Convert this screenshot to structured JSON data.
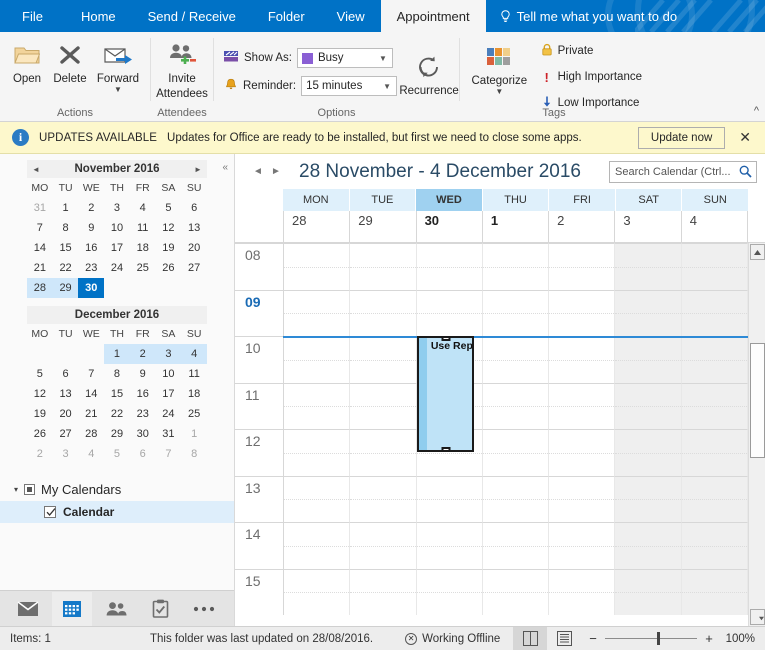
{
  "window": {
    "tabs": [
      {
        "label": "File",
        "active": false
      },
      {
        "label": "Home",
        "active": false
      },
      {
        "label": "Send / Receive",
        "active": false
      },
      {
        "label": "Folder",
        "active": false
      },
      {
        "label": "View",
        "active": false
      },
      {
        "label": "Appointment",
        "active": true
      }
    ],
    "tell_me": "Tell me what you want to do"
  },
  "ribbon": {
    "groups": {
      "actions": {
        "name": "Actions",
        "open": "Open",
        "delete": "Delete",
        "forward": "Forward"
      },
      "attendees": {
        "name": "Attendees",
        "invite_line1": "Invite",
        "invite_line2": "Attendees"
      },
      "options": {
        "name": "Options",
        "show_as_label": "Show As:",
        "show_as_value": "Busy",
        "show_as_color": "#8a5fd4",
        "reminder_label": "Reminder:",
        "reminder_value": "15 minutes",
        "recurrence": "Recurrence"
      },
      "tags": {
        "name": "Tags",
        "categorize": "Categorize",
        "private": "Private",
        "high_importance": "High Importance",
        "low_importance": "Low Importance"
      }
    }
  },
  "notification": {
    "title": "UPDATES AVAILABLE",
    "message": "Updates for Office are ready to be installed, but first we need to close some apps.",
    "button": "Update now",
    "close": "✕"
  },
  "date_navigator": {
    "months": [
      {
        "title": "November 2016",
        "dow": [
          "MO",
          "TU",
          "WE",
          "TH",
          "FR",
          "SA",
          "SU"
        ],
        "weeks": [
          [
            {
              "d": "31",
              "s": "oth"
            },
            {
              "d": "1"
            },
            {
              "d": "2"
            },
            {
              "d": "3"
            },
            {
              "d": "4"
            },
            {
              "d": "5"
            },
            {
              "d": "6"
            }
          ],
          [
            {
              "d": "7"
            },
            {
              "d": "8"
            },
            {
              "d": "9"
            },
            {
              "d": "10"
            },
            {
              "d": "11"
            },
            {
              "d": "12"
            },
            {
              "d": "13"
            }
          ],
          [
            {
              "d": "14"
            },
            {
              "d": "15"
            },
            {
              "d": "16"
            },
            {
              "d": "17"
            },
            {
              "d": "18"
            },
            {
              "d": "19"
            },
            {
              "d": "20"
            }
          ],
          [
            {
              "d": "21"
            },
            {
              "d": "22"
            },
            {
              "d": "23"
            },
            {
              "d": "24"
            },
            {
              "d": "25"
            },
            {
              "d": "26"
            },
            {
              "d": "27"
            }
          ],
          [
            {
              "d": "28",
              "s": "sel"
            },
            {
              "d": "29",
              "s": "sel"
            },
            {
              "d": "30",
              "s": "today"
            },
            {
              "d": ""
            },
            {
              "d": ""
            },
            {
              "d": ""
            },
            {
              "d": ""
            }
          ]
        ]
      },
      {
        "title": "December 2016",
        "dow": [
          "MO",
          "TU",
          "WE",
          "TH",
          "FR",
          "SA",
          "SU"
        ],
        "weeks": [
          [
            {
              "d": ""
            },
            {
              "d": ""
            },
            {
              "d": ""
            },
            {
              "d": "1",
              "s": "sel"
            },
            {
              "d": "2",
              "s": "sel"
            },
            {
              "d": "3",
              "s": "sel"
            },
            {
              "d": "4",
              "s": "sel"
            }
          ],
          [
            {
              "d": "5"
            },
            {
              "d": "6"
            },
            {
              "d": "7"
            },
            {
              "d": "8"
            },
            {
              "d": "9"
            },
            {
              "d": "10"
            },
            {
              "d": "11"
            }
          ],
          [
            {
              "d": "12"
            },
            {
              "d": "13"
            },
            {
              "d": "14"
            },
            {
              "d": "15"
            },
            {
              "d": "16"
            },
            {
              "d": "17"
            },
            {
              "d": "18"
            }
          ],
          [
            {
              "d": "19"
            },
            {
              "d": "20"
            },
            {
              "d": "21"
            },
            {
              "d": "22"
            },
            {
              "d": "23"
            },
            {
              "d": "24"
            },
            {
              "d": "25"
            }
          ],
          [
            {
              "d": "26"
            },
            {
              "d": "27"
            },
            {
              "d": "28"
            },
            {
              "d": "29"
            },
            {
              "d": "30"
            },
            {
              "d": "31"
            },
            {
              "d": "1",
              "s": "oth"
            }
          ],
          [
            {
              "d": "2",
              "s": "oth"
            },
            {
              "d": "3",
              "s": "oth"
            },
            {
              "d": "4",
              "s": "oth"
            },
            {
              "d": "5",
              "s": "oth"
            },
            {
              "d": "6",
              "s": "oth"
            },
            {
              "d": "7",
              "s": "oth"
            },
            {
              "d": "8",
              "s": "oth"
            }
          ]
        ]
      }
    ],
    "prev_arrow": "◄",
    "next_arrow": "►",
    "collapse": "«"
  },
  "folders": {
    "group_label": "My Calendars",
    "calendar_label": "Calendar",
    "expand_arrow": "▾"
  },
  "calendar": {
    "range_title": "28 November - 4 December 2016",
    "prev_arrow": "◄",
    "next_arrow": "►",
    "search_placeholder": "Search Calendar (Ctrl...",
    "day_headers": [
      {
        "label": "MON",
        "today": false
      },
      {
        "label": "TUE",
        "today": false
      },
      {
        "label": "WED",
        "today": true
      },
      {
        "label": "THU",
        "today": false
      },
      {
        "label": "FRI",
        "today": false
      },
      {
        "label": "SAT",
        "today": false
      },
      {
        "label": "SUN",
        "today": false
      }
    ],
    "day_numbers": [
      {
        "num": "28",
        "bold": false,
        "weekend": false
      },
      {
        "num": "29",
        "bold": false,
        "weekend": false
      },
      {
        "num": "30",
        "bold": true,
        "weekend": false
      },
      {
        "num": "1",
        "bold": true,
        "weekend": false
      },
      {
        "num": "2",
        "bold": false,
        "weekend": false
      },
      {
        "num": "3",
        "bold": false,
        "weekend": true
      },
      {
        "num": "4",
        "bold": false,
        "weekend": true
      }
    ],
    "hours": [
      {
        "label": "08",
        "current": false
      },
      {
        "label": "09",
        "current": true
      },
      {
        "label": "10",
        "current": false
      },
      {
        "label": "11",
        "current": false
      },
      {
        "label": "12",
        "current": false
      },
      {
        "label": "13",
        "current": false
      },
      {
        "label": "14",
        "current": false
      },
      {
        "label": "15",
        "current": false
      }
    ],
    "appointment": {
      "subject": "Use Repeat Signage",
      "fill_color": "#bfe3f7",
      "stripe_color": "#8fcdee",
      "border_color": "#1a1a1a",
      "day_index": 2,
      "start": "10:00",
      "end": "12:30"
    }
  },
  "status_bar": {
    "items": "Items: 1",
    "updated": "This folder was last updated on 28/08/2016.",
    "connection": "Working Offline",
    "zoom_value": "100%",
    "zoom_minus": "−",
    "zoom_plus": "+"
  }
}
